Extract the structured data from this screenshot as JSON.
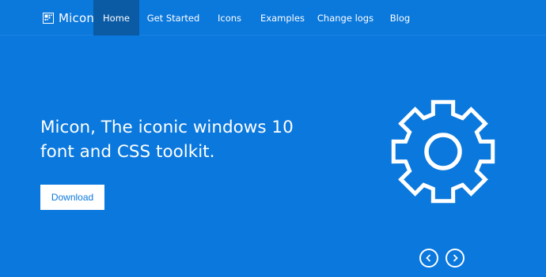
{
  "brand": {
    "name": "Micon",
    "icon": "micon-logo-icon"
  },
  "nav": {
    "items": [
      {
        "label": "Home",
        "active": true
      },
      {
        "label": "Get Started",
        "active": false
      },
      {
        "label": "Icons",
        "active": false
      },
      {
        "label": "Examples",
        "active": false
      },
      {
        "label": "Change logs",
        "active": false
      },
      {
        "label": "Blog",
        "active": false
      }
    ]
  },
  "hero": {
    "title_line1": "Micon, The iconic windows 10",
    "title_line2": "font and CSS toolkit.",
    "download_label": "Download",
    "illustration_icon": "gear-icon"
  },
  "carousel": {
    "prev_icon": "chevron-left-icon",
    "next_icon": "chevron-right-icon"
  },
  "colors": {
    "primary": "#0b78dc",
    "active_nav": "#0a5aa4",
    "text": "#ffffff"
  }
}
